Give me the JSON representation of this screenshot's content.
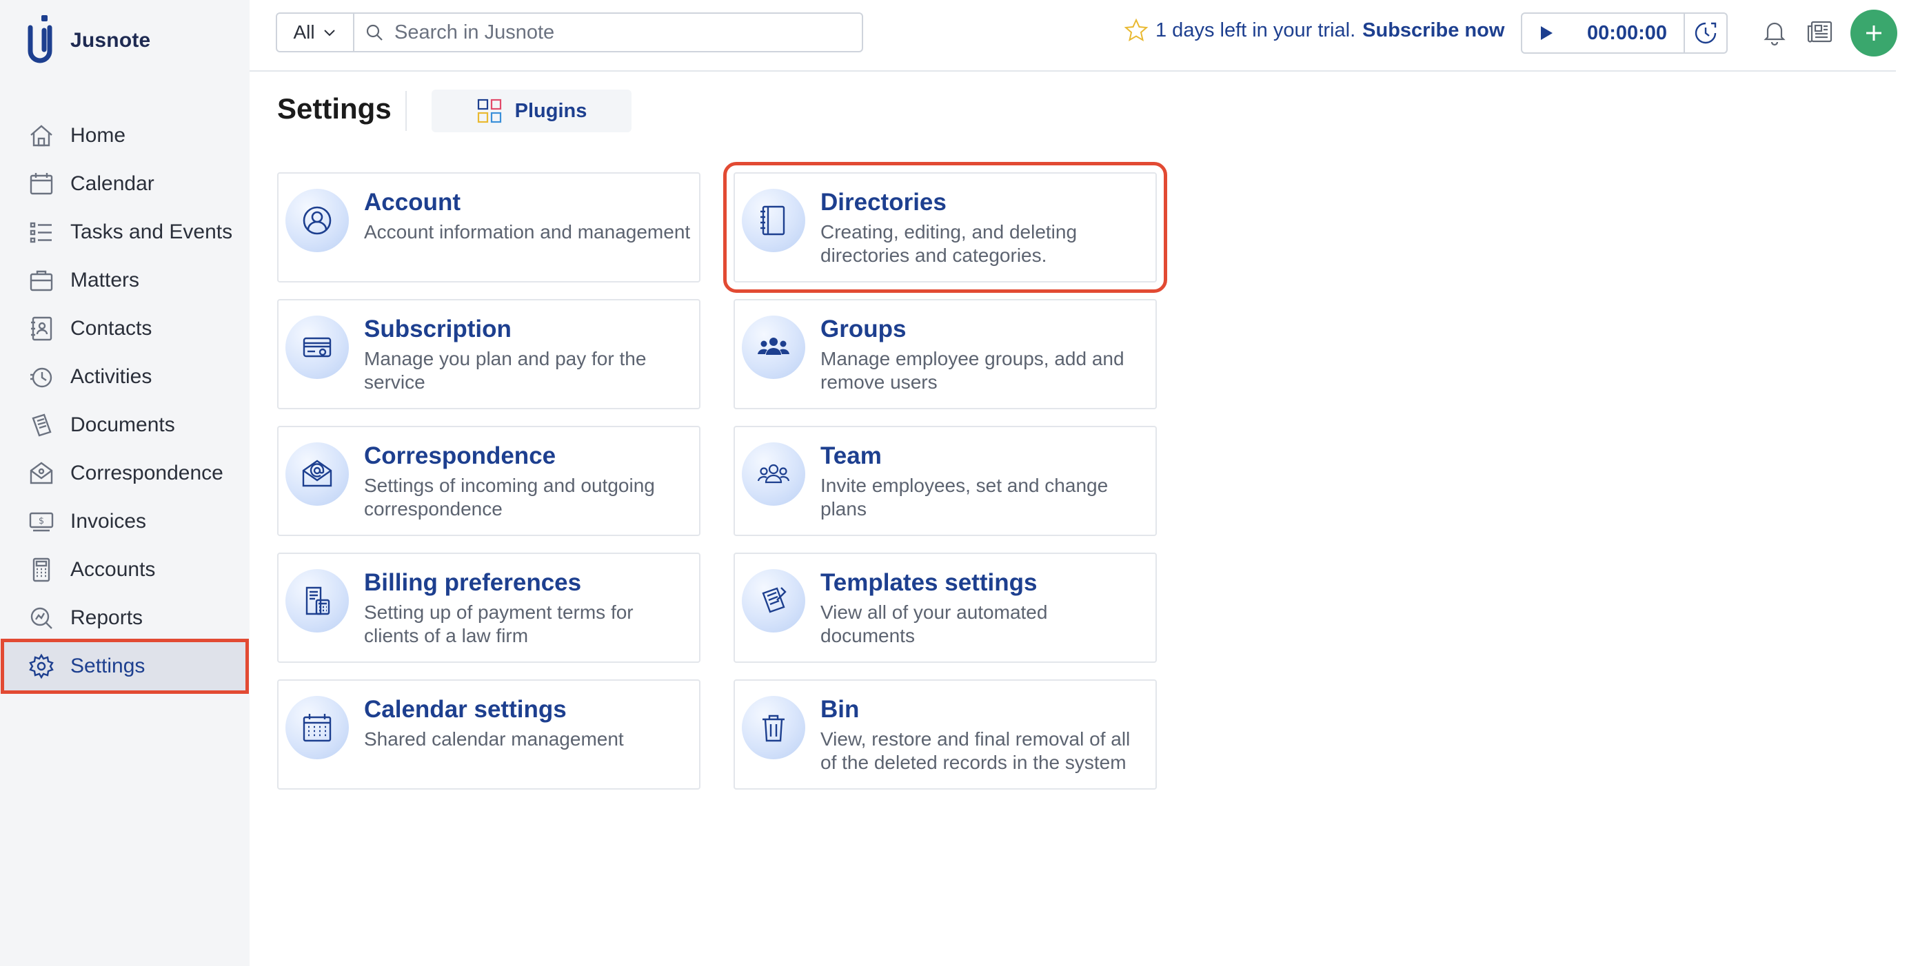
{
  "app": {
    "name": "Jusnote"
  },
  "sidebar": {
    "items": [
      {
        "label": "Home",
        "icon": "home-icon"
      },
      {
        "label": "Calendar",
        "icon": "calendar-icon"
      },
      {
        "label": "Tasks and Events",
        "icon": "tasks-icon"
      },
      {
        "label": "Matters",
        "icon": "matters-icon"
      },
      {
        "label": "Contacts",
        "icon": "contacts-icon"
      },
      {
        "label": "Activities",
        "icon": "activities-icon"
      },
      {
        "label": "Documents",
        "icon": "documents-icon"
      },
      {
        "label": "Correspondence",
        "icon": "correspondence-icon"
      },
      {
        "label": "Invoices",
        "icon": "invoices-icon"
      },
      {
        "label": "Accounts",
        "icon": "accounts-icon"
      },
      {
        "label": "Reports",
        "icon": "reports-icon"
      },
      {
        "label": "Settings",
        "icon": "gear-icon",
        "active": true
      }
    ]
  },
  "topbar": {
    "search_scope": "All",
    "search_placeholder": "Search in Jusnote",
    "trial_text": "1 days left in your trial.",
    "subscribe_label": "Subscribe now",
    "timer_value": "00:00:00"
  },
  "header": {
    "title": "Settings",
    "plugins_label": "Plugins"
  },
  "cards": {
    "account": {
      "title": "Account",
      "desc": "Account information and management"
    },
    "directories": {
      "title": "Directories",
      "desc": "Creating, editing, and deleting directories and categories."
    },
    "subscription": {
      "title": "Subscription",
      "desc": "Manage you plan and pay for the service"
    },
    "groups": {
      "title": "Groups",
      "desc": "Manage employee groups, add and remove users"
    },
    "correspondence": {
      "title": "Correspondence",
      "desc": "Settings of incoming and outgoing correspondence"
    },
    "team": {
      "title": "Team",
      "desc": "Invite employees, set and change plans"
    },
    "billing": {
      "title": "Billing preferences",
      "desc": "Setting up of payment terms for clients of a law firm"
    },
    "templates": {
      "title": "Templates settings",
      "desc": "View all of your automated documents"
    },
    "calendar": {
      "title": "Calendar settings",
      "desc": "Shared calendar management"
    },
    "bin": {
      "title": "Bin",
      "desc": "View, restore and final removal of all of the deleted records in the system"
    }
  },
  "colors": {
    "accent": "#1d3f8f",
    "highlight": "#e24a33",
    "add_button": "#3aa76d",
    "trial_star": "#e9b931"
  }
}
